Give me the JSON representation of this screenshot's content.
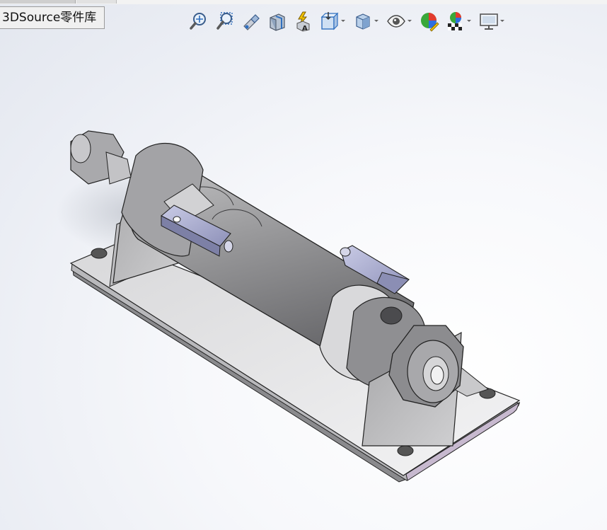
{
  "tab": {
    "label": "3DSource零件库"
  },
  "toolbar": {
    "buttons": [
      {
        "name": "zoom-to-fit-icon",
        "has_dropdown": false
      },
      {
        "name": "zoom-to-area-icon",
        "has_dropdown": false
      },
      {
        "name": "previous-view-icon",
        "has_dropdown": false
      },
      {
        "name": "section-view-icon",
        "has_dropdown": false
      },
      {
        "name": "dynamic-annotation-views-icon",
        "has_dropdown": false
      },
      {
        "name": "view-orientation-icon",
        "has_dropdown": true
      },
      {
        "name": "display-style-icon",
        "has_dropdown": true
      },
      {
        "name": "hide-show-items-icon",
        "has_dropdown": true
      },
      {
        "name": "edit-appearance-icon",
        "has_dropdown": false
      },
      {
        "name": "apply-scene-icon",
        "has_dropdown": true
      },
      {
        "name": "view-settings-icon",
        "has_dropdown": true
      }
    ]
  },
  "viewport": {
    "model": "pneumatic-cylinder-assembly",
    "colors": {
      "background_light": "#ffffff",
      "background_dark": "#e3e7ef",
      "metal": "#9c9c9e",
      "metal_dark": "#6f6f72",
      "base_plate": "#c9c9cb",
      "sensor": "#a9acd0"
    }
  }
}
